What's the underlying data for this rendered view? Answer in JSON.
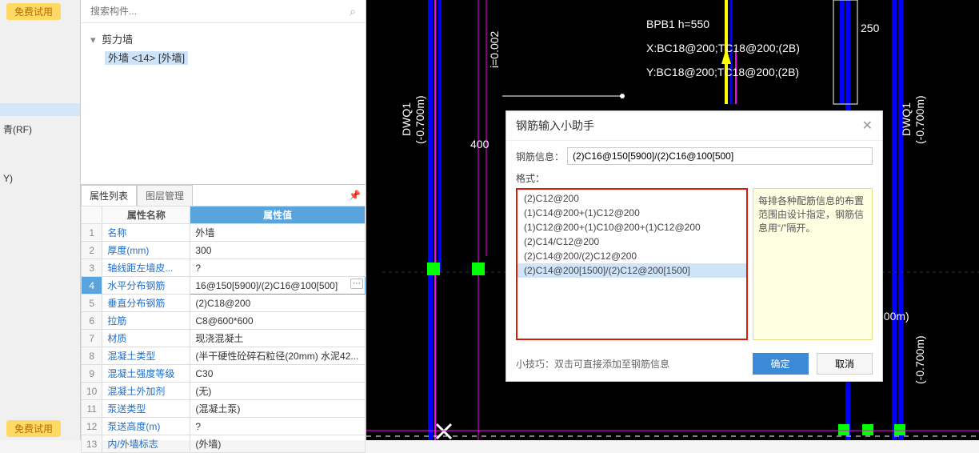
{
  "left": {
    "trial": "免费试用",
    "item_rf": "青(RF)",
    "item_y": "Y)"
  },
  "search": {
    "placeholder": "搜索构件..."
  },
  "tree": {
    "root": "剪力墙",
    "selected": "外墙 <14> [外墙]"
  },
  "tabs": {
    "prop": "属性列表",
    "layer": "图层管理"
  },
  "headers": {
    "name": "属性名称",
    "value": "属性值"
  },
  "rows": [
    {
      "n": "1",
      "k": "名称",
      "v": "外墙"
    },
    {
      "n": "2",
      "k": "厚度(mm)",
      "v": "300"
    },
    {
      "n": "3",
      "k": "轴线距左墙皮...",
      "v": "?"
    },
    {
      "n": "4",
      "k": "水平分布钢筋",
      "v": "16@150[5900]/(2)C16@100[500]"
    },
    {
      "n": "5",
      "k": "垂直分布钢筋",
      "v": "(2)C18@200"
    },
    {
      "n": "6",
      "k": "拉筋",
      "v": "C8@600*600"
    },
    {
      "n": "7",
      "k": "材质",
      "v": "现浇混凝土"
    },
    {
      "n": "8",
      "k": "混凝土类型",
      "v": "(半干硬性砼碎石粒径(20mm) 水泥42..."
    },
    {
      "n": "9",
      "k": "混凝土强度等级",
      "v": "C30"
    },
    {
      "n": "10",
      "k": "混凝土外加剂",
      "v": "(无)"
    },
    {
      "n": "11",
      "k": "泵送类型",
      "v": "(混凝土泵)"
    },
    {
      "n": "12",
      "k": "泵送高度(m)",
      "v": "?"
    },
    {
      "n": "13",
      "k": "内/外墙标志",
      "v": "(外墙)"
    }
  ],
  "dialog": {
    "title": "钢筋输入小助手",
    "info_label": "钢筋信息：",
    "info_value": "(2)C16@150[5900]/(2)C16@100[500]",
    "fmt_label": "格式：",
    "options": [
      "(2)C12@200",
      "(1)C14@200+(1)C12@200",
      "(1)C12@200+(1)C10@200+(1)C12@200",
      "(2)C14/C12@200",
      "(2)C14@200/(2)C12@200",
      "(2)C14@200[1500]/(2)C12@200[1500]"
    ],
    "hint": "每排各种配筋信息的布置范围由设计指定，钢筋信息用“/”隔开。",
    "tip": "小技巧：双击可直接添加至钢筋信息",
    "ok": "确定",
    "cancel": "取消"
  },
  "canvas": {
    "bpb": "BPB1  h=550",
    "x": "X:BC18@200;TC18@200;(2B)",
    "y": "Y:BC18@200;TC18@200;(2B)",
    "dwq1": "DWQ1",
    "depth": "(-0.700m)",
    "dim250": "250",
    "dim400": "400",
    "slope": "i=0.002"
  }
}
